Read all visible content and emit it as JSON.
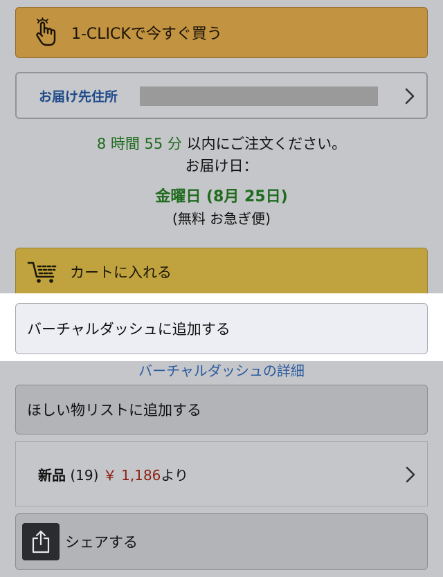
{
  "one_click": {
    "label": "1-CLICKで今すぐ買う",
    "icon": "tap-hand-icon"
  },
  "address": {
    "label": "お届け先住所"
  },
  "timer": {
    "hours": "8 時間 55 分",
    "suffix": " 以内にご注文ください。"
  },
  "delivery": {
    "label": "お届け日：",
    "date": "金曜日 (8月 25日)",
    "note": "(無料 お急ぎ便)"
  },
  "cart": {
    "label": "カートに入れる",
    "icon": "cart-icon"
  },
  "virtual_dash": {
    "add_label": "バーチャルダッシュに追加する",
    "details_link": "バーチャルダッシュの詳細"
  },
  "wishlist": {
    "label": "ほしい物リストに追加する"
  },
  "offers": {
    "label": "新品",
    "count": " (19) ",
    "price": "￥ 1,186",
    "suffix": "より"
  },
  "share": {
    "label": "シェアする",
    "icon": "share-icon"
  },
  "colors": {
    "one_click_bg": "#c29340",
    "cart_bg": "#c0a33e",
    "link_blue": "#2a5aa0",
    "green": "#1e6b1e",
    "price_red": "#8b1e10"
  }
}
